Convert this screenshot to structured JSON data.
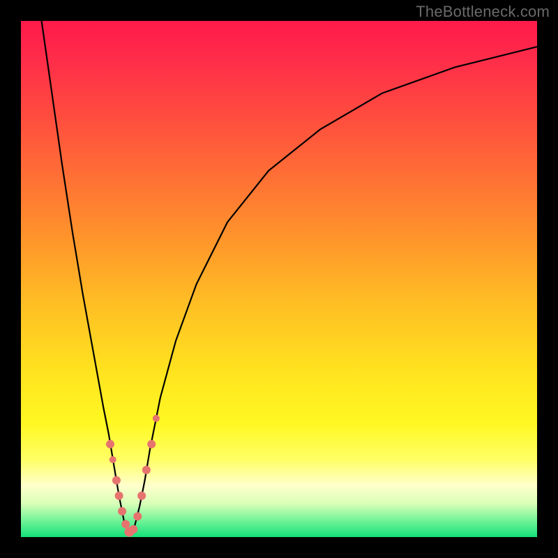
{
  "watermark": {
    "text": "TheBottleneck.com"
  },
  "gradient": {
    "stops": [
      {
        "offset": 0.0,
        "color": "#ff1a4b"
      },
      {
        "offset": 0.08,
        "color": "#ff2e49"
      },
      {
        "offset": 0.18,
        "color": "#ff4b3f"
      },
      {
        "offset": 0.3,
        "color": "#ff6f35"
      },
      {
        "offset": 0.42,
        "color": "#ff942b"
      },
      {
        "offset": 0.55,
        "color": "#ffbf24"
      },
      {
        "offset": 0.68,
        "color": "#ffe31f"
      },
      {
        "offset": 0.78,
        "color": "#fff823"
      },
      {
        "offset": 0.85,
        "color": "#ffff66"
      },
      {
        "offset": 0.9,
        "color": "#ffffcc"
      },
      {
        "offset": 0.935,
        "color": "#d9ffb8"
      },
      {
        "offset": 0.965,
        "color": "#7cf59a"
      },
      {
        "offset": 1.0,
        "color": "#14e07a"
      }
    ]
  },
  "chart_data": {
    "type": "line",
    "title": "",
    "xlabel": "",
    "ylabel": "",
    "xlim": [
      0,
      100
    ],
    "ylim": [
      0,
      100
    ],
    "minimum_at_x": 21,
    "series": [
      {
        "name": "bottleneck-curve",
        "x": [
          4,
          6,
          8,
          10,
          12,
          14,
          16,
          17,
          18,
          19,
          20,
          21,
          22,
          23,
          24,
          25,
          27,
          30,
          34,
          40,
          48,
          58,
          70,
          84,
          100
        ],
        "y": [
          100,
          86,
          72,
          59,
          47,
          36,
          25,
          20,
          14,
          8,
          3,
          0.5,
          2,
          6,
          11,
          17,
          27,
          38,
          49,
          61,
          71,
          79,
          86,
          91,
          95
        ]
      }
    ],
    "markers": {
      "name": "highlight-points",
      "points": [
        {
          "x": 17.3,
          "y": 18,
          "r": 6
        },
        {
          "x": 17.8,
          "y": 15,
          "r": 5
        },
        {
          "x": 18.5,
          "y": 11,
          "r": 6
        },
        {
          "x": 19.0,
          "y": 8,
          "r": 6
        },
        {
          "x": 19.6,
          "y": 5,
          "r": 6
        },
        {
          "x": 20.3,
          "y": 2.5,
          "r": 6
        },
        {
          "x": 21.0,
          "y": 1,
          "r": 7
        },
        {
          "x": 21.8,
          "y": 1.5,
          "r": 6
        },
        {
          "x": 22.6,
          "y": 4,
          "r": 6
        },
        {
          "x": 23.4,
          "y": 8,
          "r": 6
        },
        {
          "x": 24.3,
          "y": 13,
          "r": 6
        },
        {
          "x": 25.3,
          "y": 18,
          "r": 6
        },
        {
          "x": 26.2,
          "y": 23,
          "r": 5
        }
      ]
    }
  }
}
